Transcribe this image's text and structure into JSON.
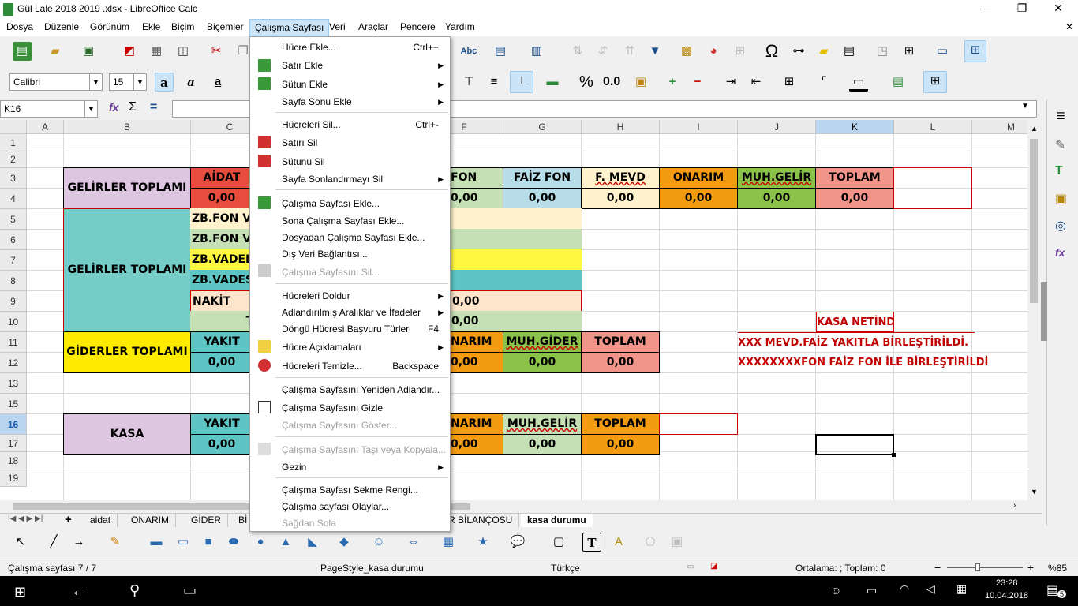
{
  "window": {
    "title": "Gül Lale 2018 2019 .xlsx - LibreOffice Calc",
    "minimize": "—",
    "restore": "❐",
    "close": "✕"
  },
  "menubar": [
    "Dosya",
    "Düzenle",
    "Görünüm",
    "Ekle",
    "Biçim",
    "Biçemler",
    "Çalışma Sayfası",
    "Veri",
    "Araçlar",
    "Pencere",
    "Yardım"
  ],
  "formatting": {
    "font_name": "Calibri",
    "font_size": "15",
    "percent": "%",
    "number": "0.0"
  },
  "formula_bar": {
    "name_box": "K16",
    "sum": "Σ",
    "equals": "="
  },
  "columns": [
    "A",
    "B",
    "C",
    "D",
    "E",
    "F",
    "G",
    "H",
    "I",
    "J",
    "K",
    "L",
    "M"
  ],
  "rows": [
    "1",
    "2",
    "3",
    "4",
    "5",
    "6",
    "7",
    "8",
    "9",
    "10",
    "11",
    "12",
    "13",
    "15",
    "16",
    "17",
    "18",
    "19"
  ],
  "cells": {
    "gelirler1": "GELİRLER TOPLAMI",
    "aidat": "AİDAT",
    "aidat_val": "0,00",
    "fon": "FON",
    "fon_val": "0,00",
    "faiz_fon": "FAİZ FON",
    "faiz_val": "0,00",
    "f_mevd": "F. MEVD",
    "mevd_val": "0,00",
    "onarim": "ONARIM",
    "onarim_val": "0,00",
    "muh_gelir": "MUH.GELİR",
    "muh_gelir_val": "0,00",
    "toplam": "TOPLAM",
    "toplam_val": "0,00",
    "gelirler2": "GELİRLER TOPLAMI",
    "zb1": "ZB.FON VA",
    "zb2": "ZB.FON VA",
    "zb3": "ZB.VADELİ",
    "zb4": "ZB.VADESİ",
    "nakit": "NAKİT",
    "t": "T",
    "nakit_val": "0,00",
    "t_val": "0,00",
    "giderler": "GİDERLER TOPLAMI",
    "yakit": "YAKIT",
    "yakit_val": "0,00",
    "g_onarim": "NARIM",
    "g_onarim_val": "0,00",
    "muh_gider": "MUH.GİDER",
    "muh_gider_val": "0,00",
    "g_toplam": "TOPLAM",
    "g_toplam_val": "0,00",
    "kasa": "KASA",
    "k_yakit": "YAKIT",
    "k_yakit_val": "0,00",
    "k_onarim": "NARIM",
    "k_onarim_val": "0,00",
    "k_muh": "MUH.GELİR",
    "k_muh_val": "0,00",
    "k_toplam": "TOPLAM",
    "k_toplam_val": "0,00",
    "note1": "KASA NETİNDE",
    "note2": "XXX MEVD.FAİZ YAKITLA BİRLEŞTİRİLDİ.",
    "note3": "XXXXXXXXFON FAİZ FON İLE BİRLEŞTİRİLDİ"
  },
  "tabs": [
    "aidat",
    "ONARIM",
    "GİDER",
    "Bİ",
    "R BİLANÇOSU",
    "kasa durumu"
  ],
  "status": {
    "sheet": "Çalışma sayfası 7 / 7",
    "pagestyle": "PageStyle_kasa durumu",
    "lang": "Türkçe",
    "sum": "Ortalama: ; Toplam: 0",
    "zoom": "%85"
  },
  "taskbar": {
    "time": "23:28",
    "date": "10.04.2018",
    "notif": "5"
  },
  "context_menu": [
    {
      "label": "Hücre Ekle...",
      "key": "Ctrl++"
    },
    {
      "label": "Satır Ekle",
      "sub": true
    },
    {
      "label": "Sütun Ekle",
      "sub": true
    },
    {
      "label": "Sayfa Sonu Ekle",
      "sub": true
    },
    {
      "label": "Hücreleri Sil...",
      "key": "Ctrl+-"
    },
    {
      "label": "Satırı Sil"
    },
    {
      "label": "Sütunu Sil"
    },
    {
      "label": "Sayfa Sonlandırmayı Sil",
      "sub": true
    },
    {
      "label": "Çalışma Sayfası Ekle..."
    },
    {
      "label": "Sona Çalışma Sayfası Ekle..."
    },
    {
      "label": "Dosyadan Çalışma Sayfası Ekle..."
    },
    {
      "label": "Dış Veri Bağlantısı..."
    },
    {
      "label": "Çalışma Sayfasını Sil...",
      "disabled": true
    },
    {
      "label": "Hücreleri Doldur",
      "sub": true
    },
    {
      "label": "Adlandırılmış Aralıklar ve İfadeler",
      "sub": true
    },
    {
      "label": "Döngü Hücresi Başvuru Türleri",
      "key": "F4"
    },
    {
      "label": "Hücre Açıklamaları",
      "sub": true
    },
    {
      "label": "Hücreleri Temizle...",
      "key": "Backspace"
    },
    {
      "label": "Çalışma Sayfasını Yeniden Adlandır..."
    },
    {
      "label": "Çalışma Sayfasını Gizle"
    },
    {
      "label": "Çalışma Sayfasını Göster...",
      "disabled": true
    },
    {
      "label": "Çalışma Sayfasını Taşı veya Kopyala...",
      "disabled": true
    },
    {
      "label": "Gezin",
      "sub": true
    },
    {
      "label": "Çalışma Sayfası Sekme Rengi..."
    },
    {
      "label": "Çalışma sayfası Olaylar..."
    },
    {
      "label": "Sağdan Sola",
      "disabled": true
    }
  ]
}
